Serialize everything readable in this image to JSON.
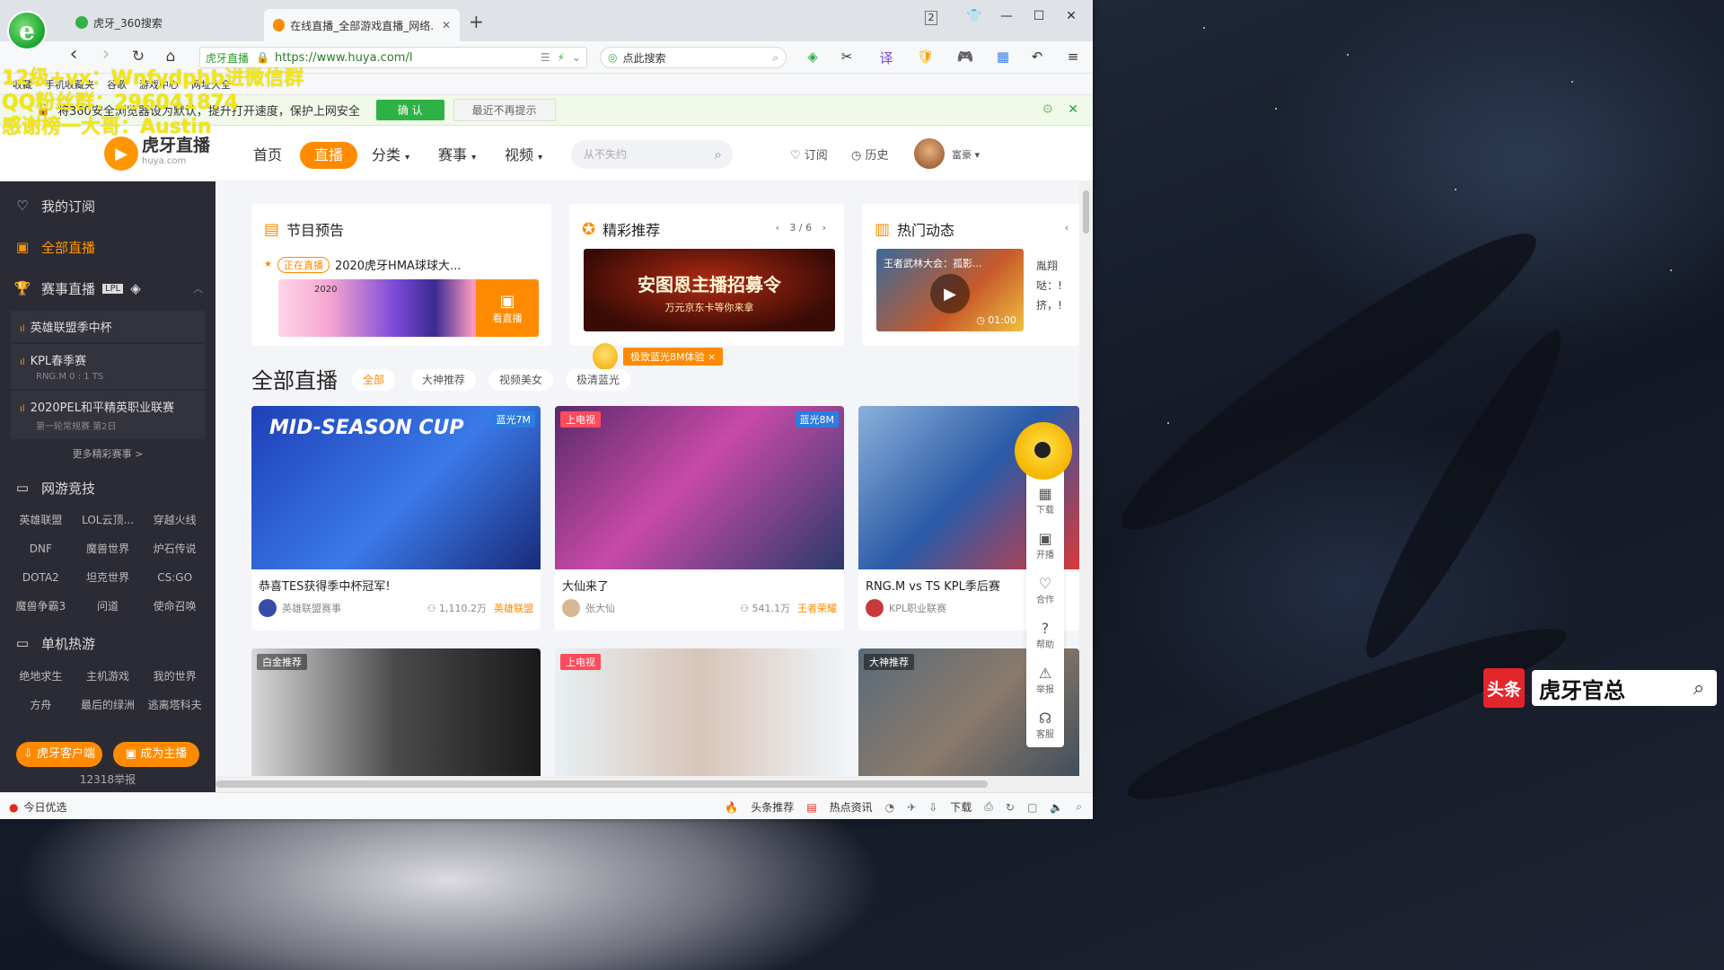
{
  "browser": {
    "tabs": [
      {
        "label": "虎牙_360搜索",
        "active": false
      },
      {
        "label": "在线直播_全部游戏直播_网络...",
        "active": true
      }
    ],
    "new_tab": "+",
    "page_num_icon": "2",
    "window_controls": {
      "shirt": "👕",
      "minimize": "—",
      "maximize": "☐",
      "close": "✕"
    },
    "nav": {
      "back": "‹",
      "forward": "›",
      "reload": "↻",
      "home": "⌂"
    },
    "site_badge": "虎牙直播",
    "url": "https://www.huya.com/l",
    "search_placeholder": "点此搜索",
    "bookmarks": [
      "收藏",
      "手机收藏夹",
      "谷歌",
      "游戏中心",
      "网址大全"
    ],
    "notice": {
      "text": "将360安全浏览器设为默认，提升打开速度，保护上网安全",
      "confirm": "确 认",
      "dismiss": "最近不再提示"
    },
    "status": {
      "left": "今日优选",
      "right": [
        "头条推荐",
        "热点资讯",
        "下载"
      ]
    }
  },
  "watermark": {
    "line1": "12级+vx：Wnfydphb进微信群",
    "line2": "QQ粉丝群：296041874",
    "line3": "感谢榜一大哥：Austin"
  },
  "huya": {
    "logo_name": "虎牙直播",
    "logo_sub": "huya.com",
    "nav": [
      "首页",
      "直播",
      "分类",
      "赛事",
      "视频"
    ],
    "search_placeholder": "从不失约",
    "subscribe": "订阅",
    "history": "历史",
    "user_level": "富豪"
  },
  "sidebar": {
    "my_sub": "我的订阅",
    "all_live": "全部直播",
    "esports": "赛事直播",
    "esports_items": [
      {
        "name": "英雄联盟季中杯",
        "meta": ""
      },
      {
        "name": "KPL春季赛",
        "meta": "RNG.M 0 : 1 TS"
      },
      {
        "name": "2020PEL和平精英职业联赛",
        "meta": "第一轮常规赛 第2日"
      }
    ],
    "more_events": "更多精彩赛事 >",
    "online_games": "网游竞技",
    "online_games_items": [
      "英雄联盟",
      "LOL云顶...",
      "穿越火线",
      "DNF",
      "魔兽世界",
      "炉石传说",
      "DOTA2",
      "坦克世界",
      "CS:GO",
      "魔兽争霸3",
      "问道",
      "使命召唤"
    ],
    "single_games": "单机热游",
    "single_games_items": [
      "绝地求生",
      "主机游戏",
      "我的世界",
      "方舟",
      "最后的绿洲",
      "逃离塔科夫"
    ],
    "client_btn": "虎牙客户端",
    "streamer_btn": "成为主播",
    "report": "12318举报"
  },
  "cards": {
    "preview": {
      "title": "节目预告",
      "live_tag": "正在直播",
      "item": "2020虎牙HMA球球大...",
      "year": "2020",
      "watch": "看直播"
    },
    "featured": {
      "title": "精彩推荐",
      "pager": "3 / 6",
      "banner_text": "安图恩主播招募令",
      "banner_sub": "万元京东卡等你来拿"
    },
    "hot": {
      "title": "热门动态",
      "video_caption": "王者武林大会：孤影...",
      "duration": "01:00",
      "side_text": [
        "胤翔",
        "哒：!",
        "挤，!"
      ]
    }
  },
  "section": {
    "title": "全部直播",
    "promo": "极致蓝光8M体验",
    "filters": [
      "全部",
      "大神推荐",
      "视频美女",
      "极清蓝光"
    ]
  },
  "lives": [
    {
      "title": "恭喜TES获得季中杯冠军!",
      "anchor": "英雄联盟赛事",
      "viewers": "1,110.2万",
      "game": "英雄联盟",
      "badge": "蓝光7M",
      "tv": "",
      "shot_text": "MID-SEASON CUP"
    },
    {
      "title": "大仙来了",
      "anchor": "张大仙",
      "viewers": "541.1万",
      "game": "王者荣耀",
      "badge": "蓝光8M",
      "tv": "上电视",
      "shot_text": ""
    },
    {
      "title": "RNG.M vs TS KPL季后赛",
      "anchor": "KPL职业联赛",
      "viewers": "",
      "game": "",
      "badge": "",
      "tv": "",
      "shot_text": ""
    },
    {
      "title": "",
      "anchor": "",
      "viewers": "",
      "game": "",
      "badge": "",
      "tv": "白金推荐",
      "shot_text": ""
    },
    {
      "title": "",
      "anchor": "",
      "viewers": "",
      "game": "",
      "badge": "",
      "tv": "上电视",
      "shot_text": ""
    },
    {
      "title": "",
      "anchor": "",
      "viewers": "",
      "game": "",
      "badge": "",
      "tv": "大神推荐",
      "shot_text": ""
    }
  ],
  "floatbar": [
    "下载",
    "开播",
    "合作",
    "帮助",
    "举报",
    "客服"
  ],
  "desktop_search": {
    "logo": "头条",
    "text": "虎牙官总"
  },
  "colors": {
    "accent": "#ff8a00",
    "sidebar": "#2b2b35",
    "notice_green": "#2fb245"
  }
}
